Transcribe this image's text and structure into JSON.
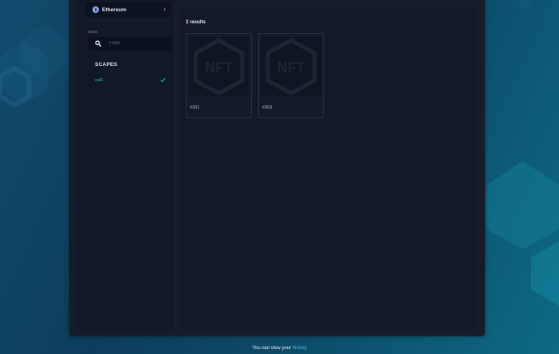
{
  "sidebar": {
    "chain": {
      "label": "Ethereum",
      "icon": "ethereum-icon",
      "chevron": "›"
    },
    "items_label": "Items",
    "filter": {
      "placeholder": "Filter",
      "value": ""
    },
    "section_title": "SCAPES",
    "collections": [
      {
        "label": "cat1",
        "selected": true,
        "icon": "check-icon"
      }
    ]
  },
  "results": {
    "count_label": "2 results",
    "cards": [
      {
        "name": "#301",
        "image_text": "NFT"
      },
      {
        "name": "#303",
        "image_text": "NFT"
      }
    ]
  },
  "footer": {
    "prefix": "You can view your",
    "link_label": "history"
  },
  "colors": {
    "accent": "#2ab7d6",
    "panel": "#151d2c",
    "sidebar": "#111928"
  }
}
